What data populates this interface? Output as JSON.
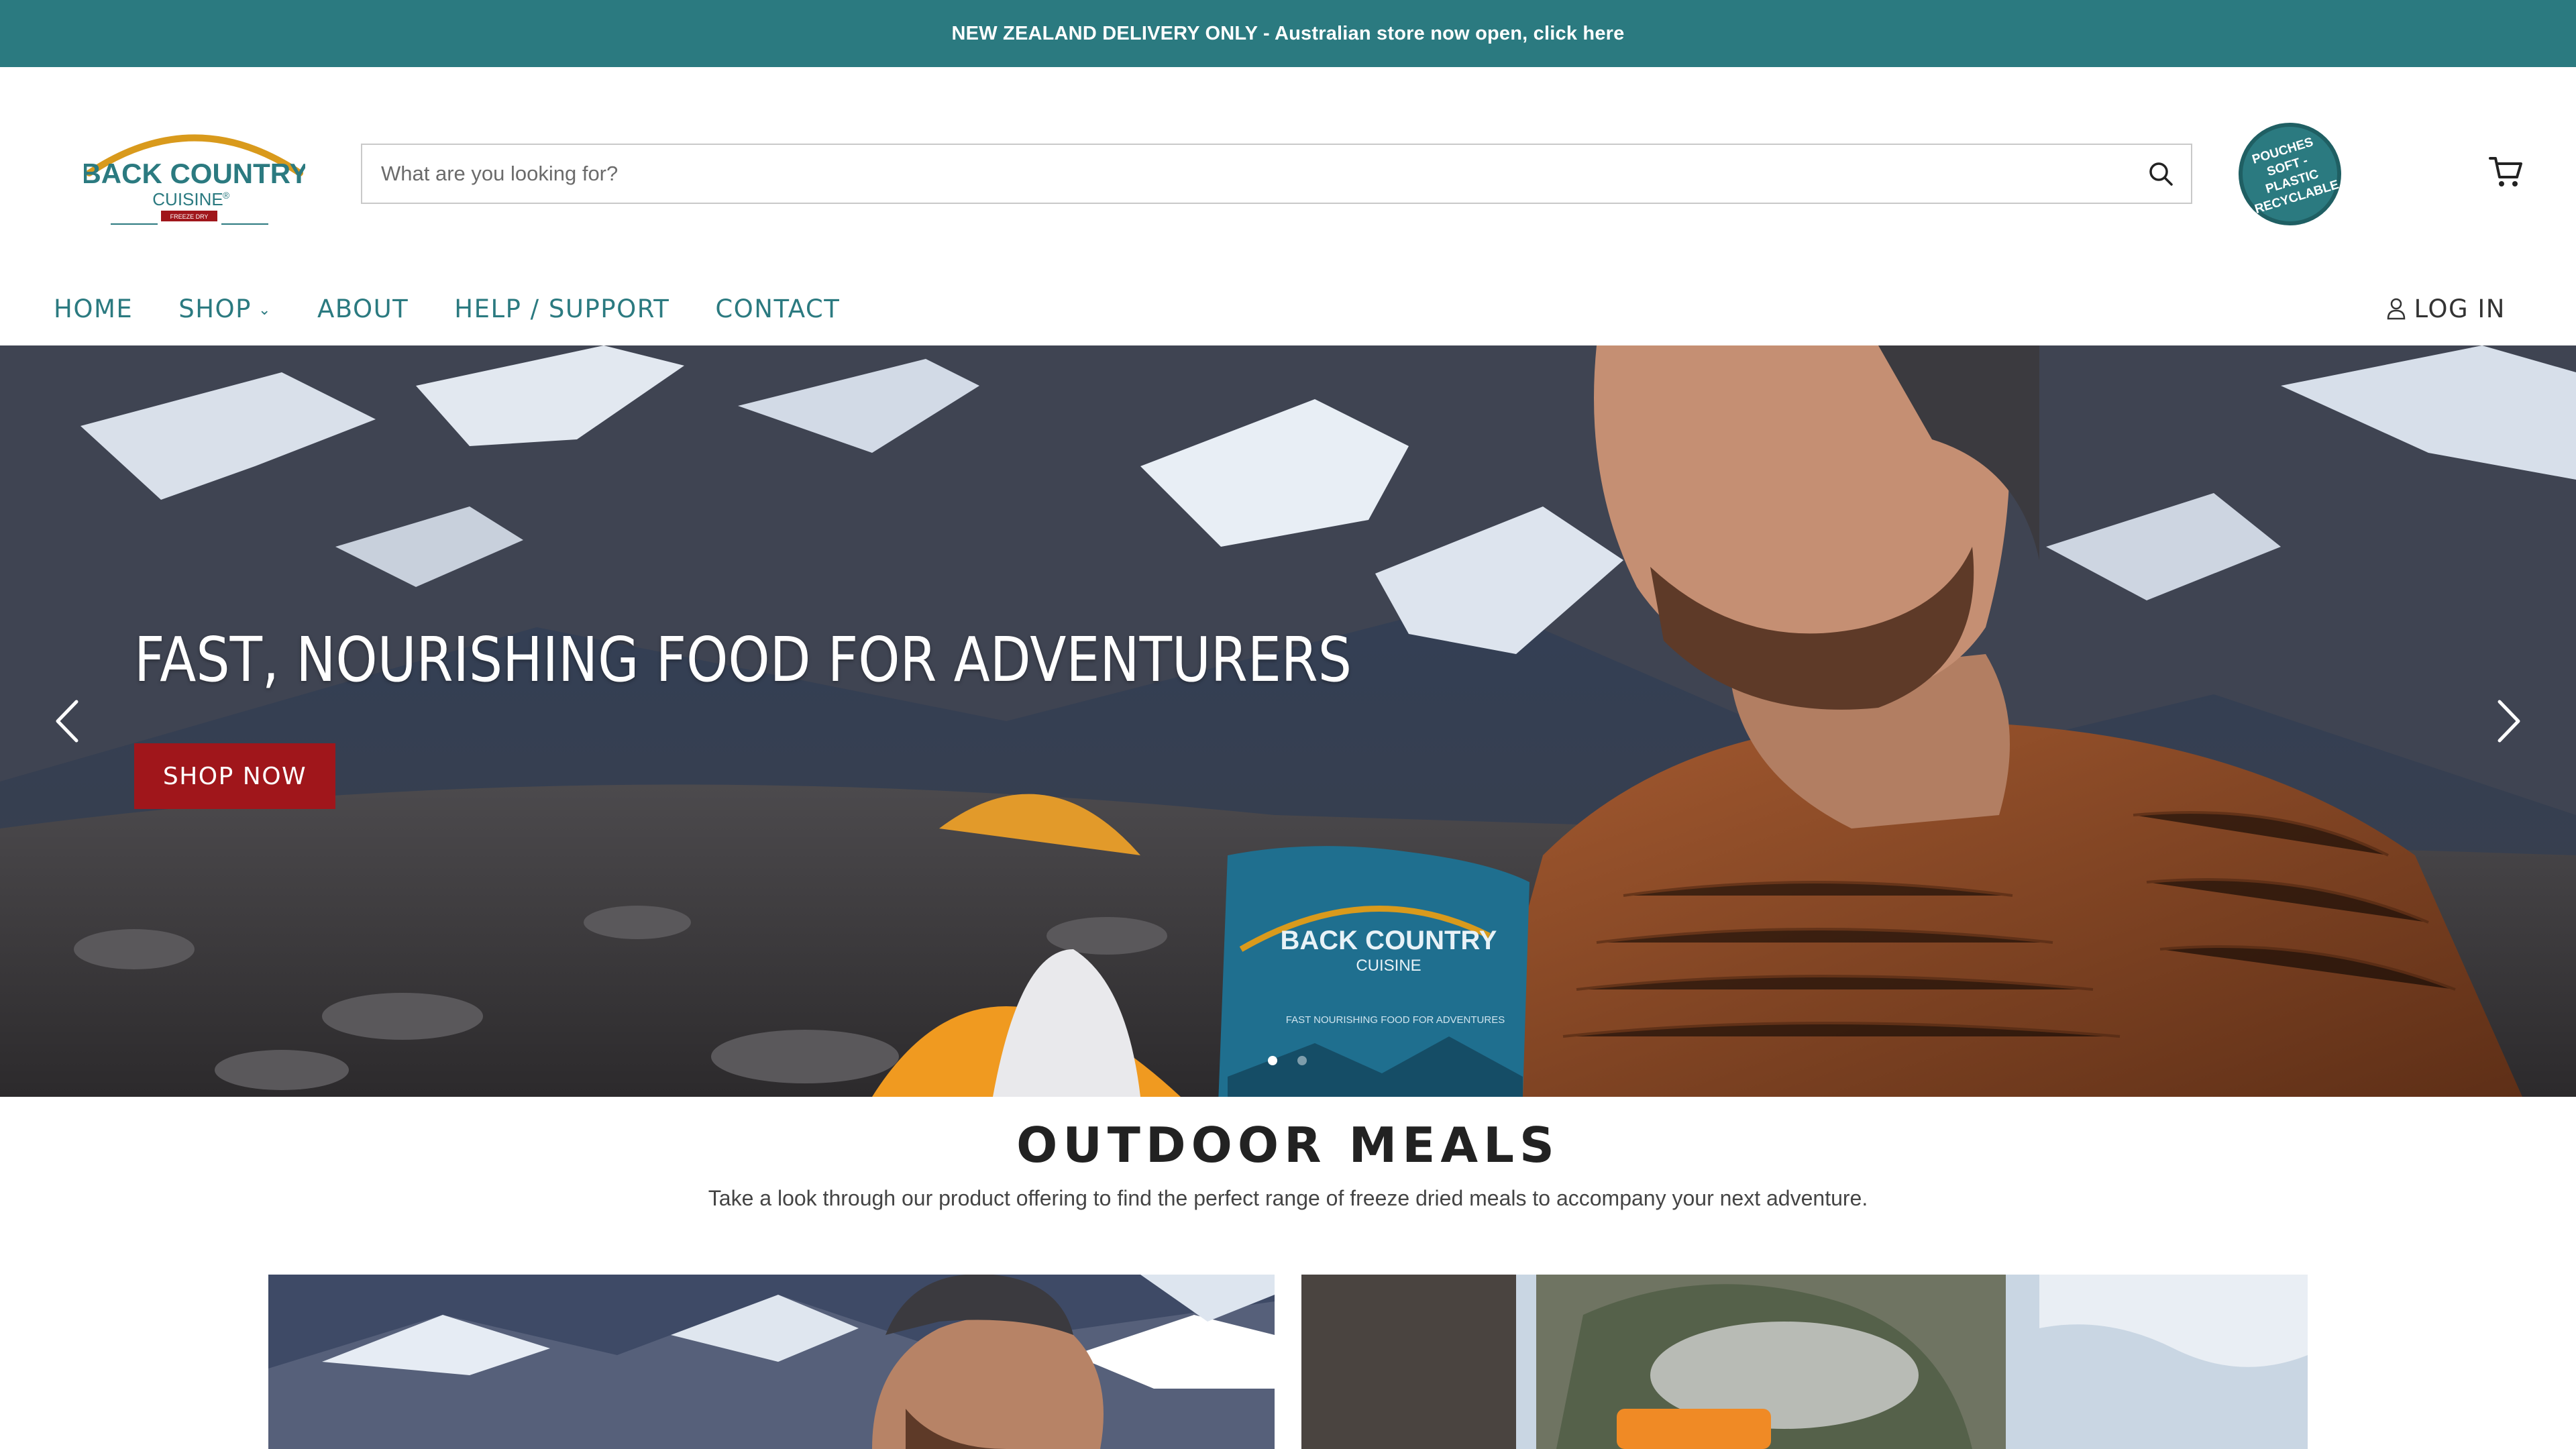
{
  "announcement": {
    "text": "NEW ZEALAND DELIVERY ONLY - Australian store now open, click here"
  },
  "header": {
    "logo": {
      "line1": "BACK COUNTRY",
      "line2": "CUISINE",
      "reg": "®",
      "tag": "FREEZE DRY"
    },
    "search": {
      "placeholder": "What are you looking for?",
      "icon": "search-icon"
    },
    "badge": {
      "line1": "POUCHES",
      "line2": "SOFT - PLASTIC",
      "line3": "RECYCLABLE"
    },
    "cart": {
      "icon": "cart-icon"
    }
  },
  "nav": {
    "items": [
      {
        "label": "HOME"
      },
      {
        "label": "SHOP",
        "has_dropdown": true
      },
      {
        "label": "ABOUT"
      },
      {
        "label": "HELP / SUPPORT"
      },
      {
        "label": "CONTACT"
      }
    ],
    "login": {
      "label": "LOG IN",
      "icon": "user-icon"
    }
  },
  "hero": {
    "title": "FAST, NOURISHING FOOD FOR ADVENTURERS",
    "button": "SHOP NOW",
    "pouch": {
      "line1": "BACK COUNTRY",
      "line2": "CUISINE",
      "tagline": "FAST NOURISHING FOOD FOR ADVENTURES"
    },
    "slides": 2,
    "active_slide": 1
  },
  "section": {
    "title": "OUTDOOR MEALS",
    "subtitle": "Take a look through our product offering to find the perfect range of freeze dried meals to accompany your next adventure."
  },
  "colors": {
    "brand_teal": "#2b7a80",
    "accent_red": "#a0161b",
    "logo_gold": "#d99a1c"
  }
}
